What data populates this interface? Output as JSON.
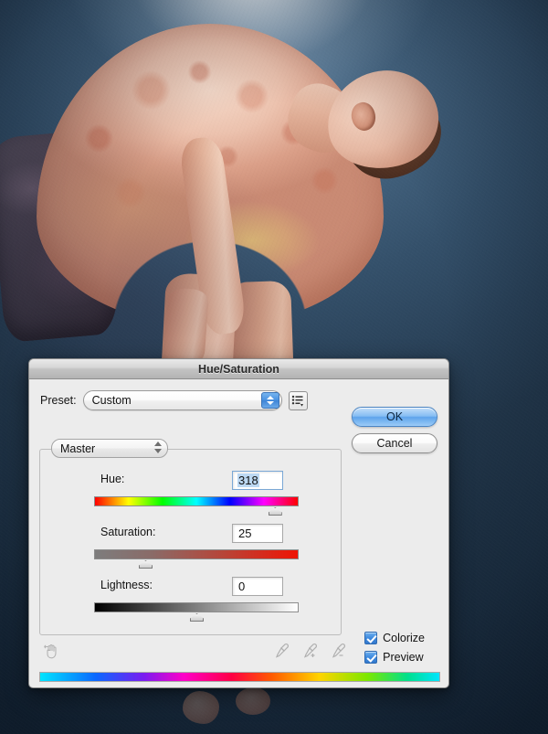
{
  "window": {
    "title": "Hue/Saturation"
  },
  "preset": {
    "label": "Preset:",
    "value": "Custom",
    "menu_icon": "list-menu-icon"
  },
  "buttons": {
    "ok": "OK",
    "cancel": "Cancel"
  },
  "channel": {
    "value": "Master"
  },
  "sliders": [
    {
      "name": "Hue:",
      "value": "318",
      "key": "hue",
      "thumb_percent": 88.3,
      "selected": true
    },
    {
      "name": "Saturation:",
      "value": "25",
      "key": "saturation",
      "thumb_percent": 25.0,
      "selected": false
    },
    {
      "name": "Lightness:",
      "value": "0",
      "key": "lightness",
      "thumb_percent": 50.0,
      "selected": false
    }
  ],
  "options": {
    "colorize": {
      "label": "Colorize",
      "checked": true
    },
    "preview": {
      "label": "Preview",
      "checked": true
    }
  },
  "tools": {
    "scrubby": "scrubby-hand-icon",
    "eyedroppers": [
      "eyedropper-icon",
      "eyedropper-plus-icon",
      "eyedropper-minus-icon"
    ]
  },
  "colors": {
    "accent": "#3f8ade",
    "dialog_bg": "#ececec",
    "result_color": "#a87a99",
    "backdrop": "#2b4259"
  }
}
